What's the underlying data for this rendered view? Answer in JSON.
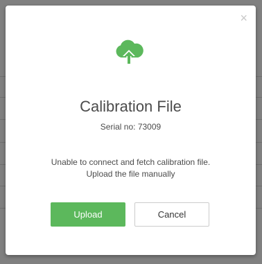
{
  "dialog": {
    "close_glyph": "×",
    "icon": "cloud-upload-icon",
    "title": "Calibration File",
    "serial": "Serial no: 73009",
    "message_line1": "Unable to connect and fetch calibration file.",
    "message_line2": "Upload the file manually",
    "upload_label": "Upload",
    "cancel_label": "Cancel"
  },
  "colors": {
    "accent": "#5cb85c",
    "overlay": "#808080"
  }
}
